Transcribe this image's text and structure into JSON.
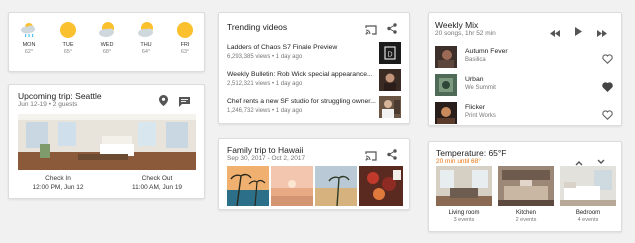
{
  "weather": {
    "days": [
      {
        "day": "MON",
        "temp": "62°",
        "icon": "rain-cloud-icon"
      },
      {
        "day": "TUE",
        "temp": "65°",
        "icon": "sun-icon"
      },
      {
        "day": "WED",
        "temp": "68°",
        "icon": "partly-cloudy-icon"
      },
      {
        "day": "THU",
        "temp": "64°",
        "icon": "partly-cloudy-icon"
      },
      {
        "day": "FRI",
        "temp": "63°",
        "icon": "sun-icon"
      }
    ]
  },
  "trip_card": {
    "title": "Upcoming trip: Seattle",
    "subtitle": "Jun 12-19 • 2 guests",
    "checkin_label": "Check In",
    "checkin_value": "12:00 PM, Jun 12",
    "checkout_label": "Check Out",
    "checkout_value": "11:00 AM, Jun 19"
  },
  "trending": {
    "title": "Trending videos",
    "videos": [
      {
        "title": "Ladders of Chaos S7 Finale Preview",
        "stats": "6,293,385 views • 1 day ago"
      },
      {
        "title": "Weekly Bulletin: Rob Wick special appearance...",
        "stats": "2,512,321 views • 1 day ago"
      },
      {
        "title": "Chef rents a new SF studio for struggling owner...",
        "stats": "1,246,732 views • 1 day ago"
      }
    ]
  },
  "family_trip": {
    "title": "Family trip to Hawaii",
    "subtitle": "Sep 30, 2017 - Oct 2, 2017"
  },
  "weekly_mix": {
    "title": "Weekly Mix",
    "subtitle": "20 songs, 1hr 52 min",
    "songs": [
      {
        "title": "Autumn Fever",
        "artist": "Basilica",
        "liked": false
      },
      {
        "title": "Urban",
        "artist": "We Summit",
        "liked": true
      },
      {
        "title": "Flicker",
        "artist": "Print Works",
        "liked": false
      }
    ]
  },
  "thermostat": {
    "title": "Temperature: 65°F",
    "subtitle": "20 min until 68°",
    "subtitle_color": "#e8710a",
    "rooms": [
      {
        "name": "Living room",
        "events": "3 events"
      },
      {
        "name": "Kitchen",
        "events": "2 events"
      },
      {
        "name": "Bedroom",
        "events": "4 events"
      }
    ]
  }
}
